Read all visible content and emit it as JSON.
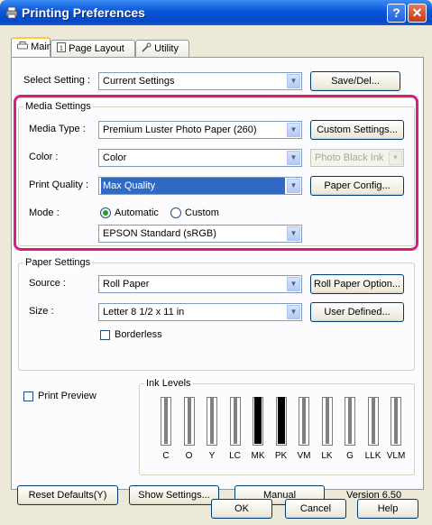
{
  "window": {
    "title": "Printing Preferences",
    "help_glyph": "?",
    "close_glyph": "✕"
  },
  "tabs": [
    {
      "label": "Main",
      "icon": "printer-icon",
      "active": true
    },
    {
      "label": "Page Layout",
      "icon": "page-icon"
    },
    {
      "label": "Utility",
      "icon": "wrench-icon"
    }
  ],
  "select_setting": {
    "label": "Select Setting :",
    "value": "Current Settings",
    "button": "Save/Del..."
  },
  "media": {
    "group_label": "Media Settings",
    "media_type": {
      "label": "Media Type :",
      "value": "Premium Luster Photo Paper (260)",
      "button": "Custom Settings..."
    },
    "color": {
      "label": "Color :",
      "value": "Color",
      "ink_value": "Photo Black Ink"
    },
    "print_quality": {
      "label": "Print Quality :",
      "value": "Max Quality",
      "button": "Paper Config..."
    },
    "mode": {
      "label": "Mode :",
      "automatic": "Automatic",
      "custom": "Custom",
      "selected": "Automatic",
      "value": "EPSON Standard (sRGB)"
    }
  },
  "paper": {
    "group_label": "Paper Settings",
    "source": {
      "label": "Source :",
      "value": "Roll Paper",
      "button": "Roll Paper Option..."
    },
    "size": {
      "label": "Size :",
      "value": "Letter 8 1/2 x 11 in",
      "button": "User Defined..."
    },
    "borderless": {
      "label": "Borderless",
      "checked": false
    }
  },
  "preview": {
    "label": "Print Preview",
    "checked": false
  },
  "ink_levels": {
    "label": "Ink Levels",
    "inks": [
      {
        "name": "C",
        "level": 0.0
      },
      {
        "name": "O",
        "level": 0.0
      },
      {
        "name": "Y",
        "level": 0.0
      },
      {
        "name": "LC",
        "level": 0.0
      },
      {
        "name": "MK",
        "level": 1.0
      },
      {
        "name": "PK",
        "level": 1.0
      },
      {
        "name": "VM",
        "level": 0.0
      },
      {
        "name": "LK",
        "level": 0.0
      },
      {
        "name": "G",
        "level": 0.0
      },
      {
        "name": "LLK",
        "level": 0.0
      },
      {
        "name": "VLM",
        "level": 0.0
      }
    ]
  },
  "bottom": {
    "reset": "Reset Defaults(Y)",
    "show_settings": "Show Settings...",
    "manual": "Manual",
    "version": "Version 6.50"
  },
  "dialog": {
    "ok": "OK",
    "cancel": "Cancel",
    "help": "Help"
  },
  "colors": {
    "highlight": "#d4207a",
    "selection": "#316ac5",
    "title_bar": "#0a55d8"
  }
}
